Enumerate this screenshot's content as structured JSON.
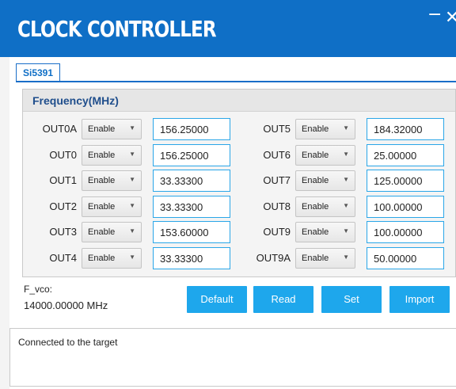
{
  "window": {
    "title": "CLOCK CONTROLLER",
    "minimize": "−",
    "close": "✕"
  },
  "tab": {
    "label": "Si5391"
  },
  "frequency": {
    "title": "Frequency(MHz)",
    "left": [
      {
        "name": "OUT0A",
        "mode": "Enable",
        "value": "156.25000"
      },
      {
        "name": "OUT0",
        "mode": "Enable",
        "value": "156.25000"
      },
      {
        "name": "OUT1",
        "mode": "Enable",
        "value": "33.33300"
      },
      {
        "name": "OUT2",
        "mode": "Enable",
        "value": "33.33300"
      },
      {
        "name": "OUT3",
        "mode": "Enable",
        "value": "153.60000"
      },
      {
        "name": "OUT4",
        "mode": "Enable",
        "value": "33.33300"
      }
    ],
    "right": [
      {
        "name": "OUT5",
        "mode": "Enable",
        "value": "184.32000"
      },
      {
        "name": "OUT6",
        "mode": "Enable",
        "value": "25.00000"
      },
      {
        "name": "OUT7",
        "mode": "Enable",
        "value": "125.00000"
      },
      {
        "name": "OUT8",
        "mode": "Enable",
        "value": "100.00000"
      },
      {
        "name": "OUT9",
        "mode": "Enable",
        "value": "100.00000"
      },
      {
        "name": "OUT9A",
        "mode": "Enable",
        "value": "50.00000"
      }
    ]
  },
  "fvco": {
    "label": "F_vco:",
    "value": "14000.00000 MHz"
  },
  "buttons": {
    "default": "Default",
    "read": "Read",
    "set": "Set",
    "import": "Import"
  },
  "status": {
    "text": "Connected to the target"
  },
  "colors": {
    "titlebar": "#0f6fc6",
    "button": "#1ea7ec",
    "input_border": "#2aa6e8",
    "panel_title": "#1f4e8c"
  }
}
